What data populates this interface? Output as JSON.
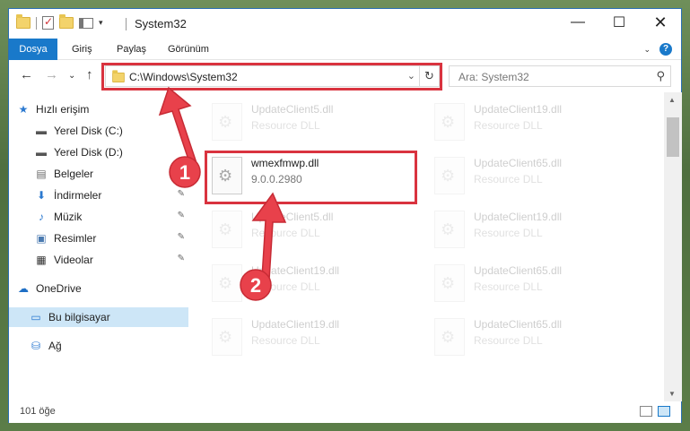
{
  "window": {
    "title": "System32",
    "controls": {
      "minimize": "—",
      "maximize": "☐",
      "close": "✕"
    }
  },
  "ribbon": {
    "tabs": [
      {
        "label": "Dosya"
      },
      {
        "label": "Giriş"
      },
      {
        "label": "Paylaş"
      },
      {
        "label": "Görünüm"
      }
    ],
    "help": "?",
    "collapse": "⌄"
  },
  "nav": {
    "back": "←",
    "forward": "→",
    "recent": "⌄",
    "up": "↑",
    "address_path": "C:\\Windows\\System32",
    "address_dropdown": "⌄",
    "refresh": "↻",
    "search_placeholder": "Ara: System32",
    "search_icon": "⚲"
  },
  "sidebar": {
    "items": [
      {
        "label": "Hızlı erişim",
        "icon": "star-icon",
        "glyph": "★",
        "color": "#2b79d0"
      },
      {
        "label": "Yerel Disk (C:)",
        "icon": "drive-icon",
        "glyph": "▬",
        "color": "#555555"
      },
      {
        "label": "Yerel Disk (D:)",
        "icon": "drive-icon",
        "glyph": "▬",
        "color": "#555555"
      },
      {
        "label": "Belgeler",
        "icon": "documents-icon",
        "glyph": "▤",
        "color": "#6b6b6b"
      },
      {
        "label": "İndirmeler",
        "icon": "downloads-icon",
        "glyph": "⬇",
        "color": "#2b79d0"
      },
      {
        "label": "Müzik",
        "icon": "music-icon",
        "glyph": "♪",
        "color": "#2b79d0"
      },
      {
        "label": "Resimler",
        "icon": "pictures-icon",
        "glyph": "▣",
        "color": "#4a7ab0"
      },
      {
        "label": "Videolar",
        "icon": "videos-icon",
        "glyph": "▦",
        "color": "#333333"
      },
      {
        "label": "OneDrive",
        "icon": "onedrive-icon",
        "glyph": "☁",
        "color": "#1f6fc5"
      },
      {
        "label": "Bu bilgisayar",
        "icon": "computer-icon",
        "glyph": "▭",
        "color": "#2b79d0"
      },
      {
        "label": "Ağ",
        "icon": "network-icon",
        "glyph": "⛁",
        "color": "#2b79d0"
      }
    ],
    "pin_glyph": "📌"
  },
  "files": [
    {
      "name": "UpdateClient5.dll",
      "sub": "Resource DLL"
    },
    {
      "name": "UpdateClient19.dll",
      "sub": "Resource DLL"
    },
    {
      "name": "wmexfmwp.dll",
      "sub": "9.0.0.2980"
    },
    {
      "name": "UpdateClient65.dll",
      "sub": "Resource DLL"
    },
    {
      "name": "UpdateClient5.dll",
      "sub": "Resource DLL"
    },
    {
      "name": "UpdateClient19.dll",
      "sub": "Resource DLL"
    },
    {
      "name": "UpdateClient19.dll",
      "sub": "Resource DLL"
    },
    {
      "name": "UpdateClient65.dll",
      "sub": "Resource DLL"
    },
    {
      "name": "UpdateClient19.dll",
      "sub": "Resource DLL"
    },
    {
      "name": "UpdateClient65.dll",
      "sub": "Resource DLL"
    }
  ],
  "status": {
    "count": "101 öğe"
  },
  "annotations": {
    "badge1": "1",
    "badge2": "2",
    "highlight_color": "#d9333f"
  }
}
